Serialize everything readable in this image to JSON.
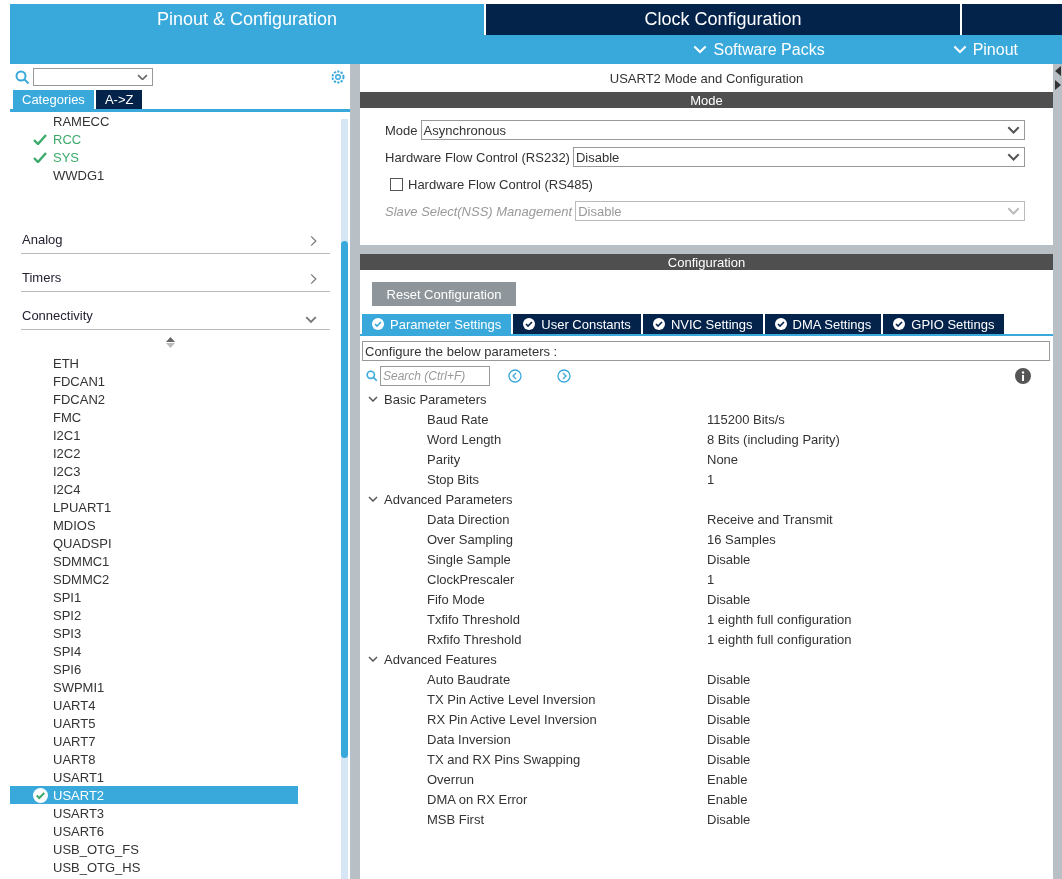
{
  "top_tabs": [
    {
      "label": "Pinout & Configuration",
      "selected": true
    },
    {
      "label": "Clock Configuration",
      "selected": false
    }
  ],
  "sub_menu": [
    {
      "label": "Software Packs"
    },
    {
      "label": "Pinout"
    }
  ],
  "sidebar": {
    "view_tabs": [
      {
        "label": "Categories",
        "selected": true
      },
      {
        "label": "A->Z",
        "selected": false
      }
    ],
    "top_items": [
      {
        "label": "RAMECC",
        "checked": false
      },
      {
        "label": "RCC",
        "checked": true
      },
      {
        "label": "SYS",
        "checked": true
      },
      {
        "label": "WWDG1",
        "checked": false
      }
    ],
    "categories": [
      {
        "label": "Analog",
        "expanded": false
      },
      {
        "label": "Timers",
        "expanded": false
      },
      {
        "label": "Connectivity",
        "expanded": true
      }
    ],
    "items": [
      {
        "label": "ETH",
        "checked": false,
        "selected": false
      },
      {
        "label": "FDCAN1",
        "checked": false,
        "selected": false
      },
      {
        "label": "FDCAN2",
        "checked": false,
        "selected": false
      },
      {
        "label": "FMC",
        "checked": false,
        "selected": false
      },
      {
        "label": "I2C1",
        "checked": false,
        "selected": false
      },
      {
        "label": "I2C2",
        "checked": false,
        "selected": false
      },
      {
        "label": "I2C3",
        "checked": false,
        "selected": false
      },
      {
        "label": "I2C4",
        "checked": false,
        "selected": false
      },
      {
        "label": "LPUART1",
        "checked": false,
        "selected": false
      },
      {
        "label": "MDIOS",
        "checked": false,
        "selected": false
      },
      {
        "label": "QUADSPI",
        "checked": false,
        "selected": false
      },
      {
        "label": "SDMMC1",
        "checked": false,
        "selected": false
      },
      {
        "label": "SDMMC2",
        "checked": false,
        "selected": false
      },
      {
        "label": "SPI1",
        "checked": false,
        "selected": false
      },
      {
        "label": "SPI2",
        "checked": false,
        "selected": false
      },
      {
        "label": "SPI3",
        "checked": false,
        "selected": false
      },
      {
        "label": "SPI4",
        "checked": false,
        "selected": false
      },
      {
        "label": "SPI6",
        "checked": false,
        "selected": false
      },
      {
        "label": "SWPMI1",
        "checked": false,
        "selected": false
      },
      {
        "label": "UART4",
        "checked": false,
        "selected": false
      },
      {
        "label": "UART5",
        "checked": false,
        "selected": false
      },
      {
        "label": "UART7",
        "checked": false,
        "selected": false
      },
      {
        "label": "UART8",
        "checked": false,
        "selected": false
      },
      {
        "label": "USART1",
        "checked": false,
        "selected": false
      },
      {
        "label": "USART2",
        "checked": true,
        "selected": true
      },
      {
        "label": "USART3",
        "checked": false,
        "selected": false
      },
      {
        "label": "USART6",
        "checked": false,
        "selected": false
      },
      {
        "label": "USB_OTG_FS",
        "checked": false,
        "selected": false
      },
      {
        "label": "USB_OTG_HS",
        "checked": false,
        "selected": false
      }
    ]
  },
  "panel": {
    "title": "USART2 Mode and Configuration",
    "mode_header": "Mode",
    "mode_fields": [
      {
        "kind": "select",
        "label": "Mode",
        "value": "Asynchronous",
        "disabled": false
      },
      {
        "kind": "select",
        "label": "Hardware Flow Control (RS232)",
        "value": "Disable",
        "disabled": false
      },
      {
        "kind": "checkbox",
        "label": "Hardware Flow Control (RS485)",
        "checked": false
      },
      {
        "kind": "select",
        "label": "Slave Select(NSS) Management",
        "value": "Disable",
        "disabled": true
      }
    ],
    "config_header": "Configuration",
    "reset_button": "Reset Configuration",
    "config_tabs": [
      {
        "label": "Parameter Settings",
        "selected": true
      },
      {
        "label": "User Constants",
        "selected": false
      },
      {
        "label": "NVIC Settings",
        "selected": false
      },
      {
        "label": "DMA Settings",
        "selected": false
      },
      {
        "label": "GPIO Settings",
        "selected": false
      }
    ],
    "description": "Configure the below parameters :",
    "search": {
      "placeholder": "Search (Ctrl+F)"
    },
    "groups": [
      {
        "label": "Basic Parameters",
        "expanded": true,
        "children": [
          {
            "name": "Baud Rate",
            "value": "115200 Bits/s"
          },
          {
            "name": "Word Length",
            "value": "8 Bits (including Parity)"
          },
          {
            "name": "Parity",
            "value": "None"
          },
          {
            "name": "Stop Bits",
            "value": "1"
          }
        ]
      },
      {
        "label": "Advanced Parameters",
        "expanded": true,
        "children": [
          {
            "name": "Data Direction",
            "value": "Receive and Transmit"
          },
          {
            "name": "Over Sampling",
            "value": "16 Samples"
          },
          {
            "name": "Single Sample",
            "value": "Disable"
          },
          {
            "name": "ClockPrescaler",
            "value": "1"
          },
          {
            "name": "Fifo Mode",
            "value": "Disable"
          },
          {
            "name": "Txfifo Threshold",
            "value": "1 eighth full configuration"
          },
          {
            "name": "Rxfifo Threshold",
            "value": "1 eighth full configuration"
          }
        ]
      },
      {
        "label": "Advanced Features",
        "expanded": true,
        "children": [
          {
            "name": "Auto Baudrate",
            "value": "Disable"
          },
          {
            "name": "TX Pin Active Level Inversion",
            "value": "Disable"
          },
          {
            "name": "RX Pin Active Level Inversion",
            "value": "Disable"
          },
          {
            "name": "Data Inversion",
            "value": "Disable"
          },
          {
            "name": "TX and RX Pins Swapping",
            "value": "Disable"
          },
          {
            "name": "Overrun",
            "value": "Enable"
          },
          {
            "name": "DMA on RX Error",
            "value": "Enable"
          },
          {
            "name": "MSB First",
            "value": "Disable"
          }
        ]
      }
    ]
  }
}
